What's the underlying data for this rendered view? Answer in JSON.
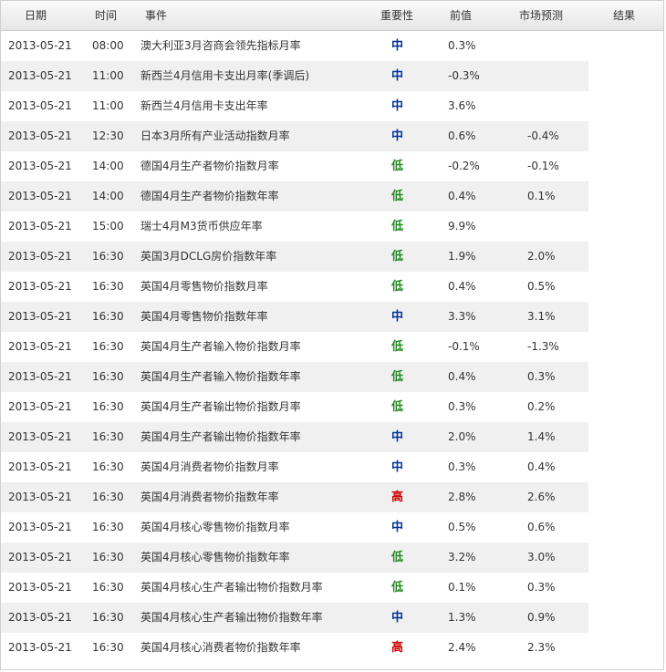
{
  "headers": {
    "date": "日期",
    "time": "时间",
    "event": "事件",
    "importance": "重要性",
    "previous": "前值",
    "forecast": "市场预测",
    "result": "结果"
  },
  "importance_colors": {
    "高": "#cc0000",
    "中": "#003399",
    "低": "#228822"
  },
  "rows": [
    {
      "date": "2013-05-21",
      "time": "08:00",
      "event": "澳大利亚3月咨商会领先指标月率",
      "importance": "中",
      "previous": "0.3%",
      "forecast": ""
    },
    {
      "date": "2013-05-21",
      "time": "11:00",
      "event": "新西兰4月信用卡支出月率(季调后)",
      "importance": "中",
      "previous": "-0.3%",
      "forecast": ""
    },
    {
      "date": "2013-05-21",
      "time": "11:00",
      "event": "新西兰4月信用卡支出年率",
      "importance": "中",
      "previous": "3.6%",
      "forecast": ""
    },
    {
      "date": "2013-05-21",
      "time": "12:30",
      "event": "日本3月所有产业活动指数月率",
      "importance": "中",
      "previous": "0.6%",
      "forecast": "-0.4%"
    },
    {
      "date": "2013-05-21",
      "time": "14:00",
      "event": "德国4月生产者物价指数月率",
      "importance": "低",
      "previous": "-0.2%",
      "forecast": "-0.1%"
    },
    {
      "date": "2013-05-21",
      "time": "14:00",
      "event": "德国4月生产者物价指数年率",
      "importance": "低",
      "previous": "0.4%",
      "forecast": "0.1%"
    },
    {
      "date": "2013-05-21",
      "time": "15:00",
      "event": "瑞士4月M3货币供应年率",
      "importance": "低",
      "previous": "9.9%",
      "forecast": ""
    },
    {
      "date": "2013-05-21",
      "time": "16:30",
      "event": "英国3月DCLG房价指数年率",
      "importance": "低",
      "previous": "1.9%",
      "forecast": "2.0%"
    },
    {
      "date": "2013-05-21",
      "time": "16:30",
      "event": "英国4月零售物价指数月率",
      "importance": "低",
      "previous": "0.4%",
      "forecast": "0.5%"
    },
    {
      "date": "2013-05-21",
      "time": "16:30",
      "event": "英国4月零售物价指数年率",
      "importance": "中",
      "previous": "3.3%",
      "forecast": "3.1%"
    },
    {
      "date": "2013-05-21",
      "time": "16:30",
      "event": "英国4月生产者输入物价指数月率",
      "importance": "低",
      "previous": "-0.1%",
      "forecast": "-1.3%"
    },
    {
      "date": "2013-05-21",
      "time": "16:30",
      "event": "英国4月生产者输入物价指数年率",
      "importance": "低",
      "previous": "0.4%",
      "forecast": "0.3%"
    },
    {
      "date": "2013-05-21",
      "time": "16:30",
      "event": "英国4月生产者输出物价指数月率",
      "importance": "低",
      "previous": "0.3%",
      "forecast": "0.2%"
    },
    {
      "date": "2013-05-21",
      "time": "16:30",
      "event": "英国4月生产者输出物价指数年率",
      "importance": "中",
      "previous": "2.0%",
      "forecast": "1.4%"
    },
    {
      "date": "2013-05-21",
      "time": "16:30",
      "event": "英国4月消费者物价指数月率",
      "importance": "中",
      "previous": "0.3%",
      "forecast": "0.4%"
    },
    {
      "date": "2013-05-21",
      "time": "16:30",
      "event": "英国4月消费者物价指数年率",
      "importance": "高",
      "previous": "2.8%",
      "forecast": "2.6%"
    },
    {
      "date": "2013-05-21",
      "time": "16:30",
      "event": "英国4月核心零售物价指数月率",
      "importance": "中",
      "previous": "0.5%",
      "forecast": "0.6%"
    },
    {
      "date": "2013-05-21",
      "time": "16:30",
      "event": "英国4月核心零售物价指数年率",
      "importance": "低",
      "previous": "3.2%",
      "forecast": "3.0%"
    },
    {
      "date": "2013-05-21",
      "time": "16:30",
      "event": "英国4月核心生产者输出物价指数月率",
      "importance": "低",
      "previous": "0.1%",
      "forecast": "0.3%"
    },
    {
      "date": "2013-05-21",
      "time": "16:30",
      "event": "英国4月核心生产者输出物价指数年率",
      "importance": "中",
      "previous": "1.3%",
      "forecast": "0.9%"
    },
    {
      "date": "2013-05-21",
      "time": "16:30",
      "event": "英国4月核心消费者物价指数年率",
      "importance": "高",
      "previous": "2.4%",
      "forecast": "2.3%"
    }
  ]
}
